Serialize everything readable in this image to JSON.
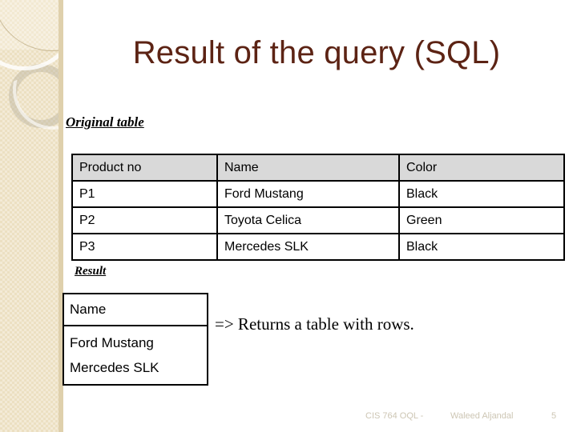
{
  "slide": {
    "title": "Result of the query (SQL)",
    "title_color": "#5c2314",
    "background_color": "#ffffff",
    "sidebar_color": "#ece0c2"
  },
  "sections": {
    "original_caption": "Original table",
    "result_caption": "Result"
  },
  "original_table": {
    "headers": [
      "Product no",
      "Name",
      "Color"
    ],
    "header_background": "#d9d9d9",
    "rows": [
      [
        "P1",
        "Ford Mustang",
        "Black"
      ],
      [
        "P2",
        "Toyota Celica",
        "Green"
      ],
      [
        "P3",
        "Mercedes SLK",
        "Black"
      ]
    ]
  },
  "result_table": {
    "header": "Name",
    "values": [
      "Ford Mustang",
      "Mercedes SLK"
    ]
  },
  "annotation": {
    "returns_note": "=> Returns a table with rows."
  },
  "footer": {
    "course": "CIS 764 OQL -",
    "author": "Waleed Aljandal",
    "page": "5",
    "color": "#cdc6b4"
  }
}
